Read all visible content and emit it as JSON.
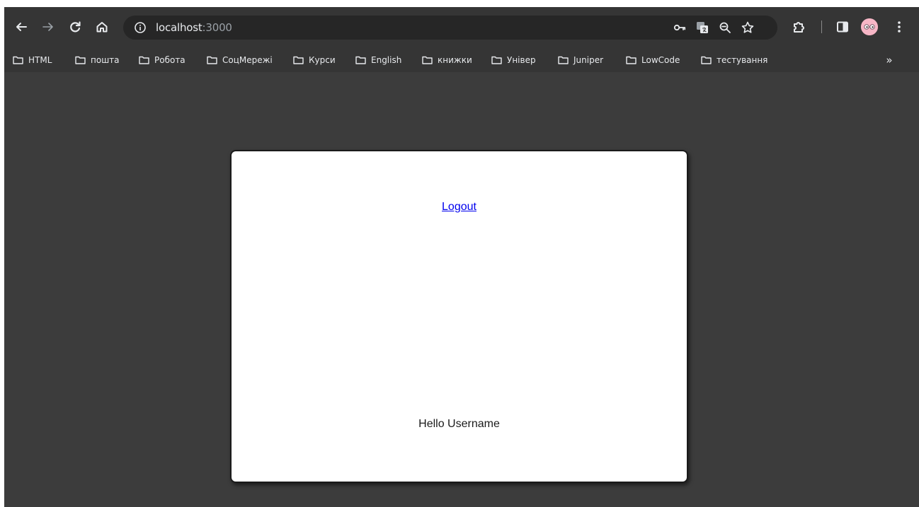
{
  "browser": {
    "url_host": "localhost",
    "url_port": ":3000",
    "icons": {
      "back": "arrow-left-icon",
      "forward": "arrow-right-icon",
      "reload": "reload-icon",
      "home": "home-icon",
      "site_info": "info-icon",
      "password": "key-icon",
      "translate": "translate-icon",
      "zoom": "zoom-out-icon",
      "bookmark": "star-icon",
      "extensions": "puzzle-icon",
      "side_panel": "side-panel-icon",
      "profile": "avatar-icon",
      "menu": "kebab-menu-icon"
    },
    "bookmarks": [
      {
        "label": "HTML"
      },
      {
        "label": "пошта"
      },
      {
        "label": "Робота"
      },
      {
        "label": "СоцМережі"
      },
      {
        "label": "Курси"
      },
      {
        "label": "English"
      },
      {
        "label": "книжки"
      },
      {
        "label": "Універ"
      },
      {
        "label": "Juniper"
      },
      {
        "label": "LowCode"
      },
      {
        "label": "тестування"
      }
    ],
    "bookmarks_more": "»"
  },
  "page": {
    "logout_label": "Logout",
    "greeting": "Hello Username"
  },
  "colors": {
    "toolbar_bg": "#353535",
    "page_bg": "#3c3c3c",
    "card_bg": "#ffffff",
    "link": "#0000ee"
  }
}
